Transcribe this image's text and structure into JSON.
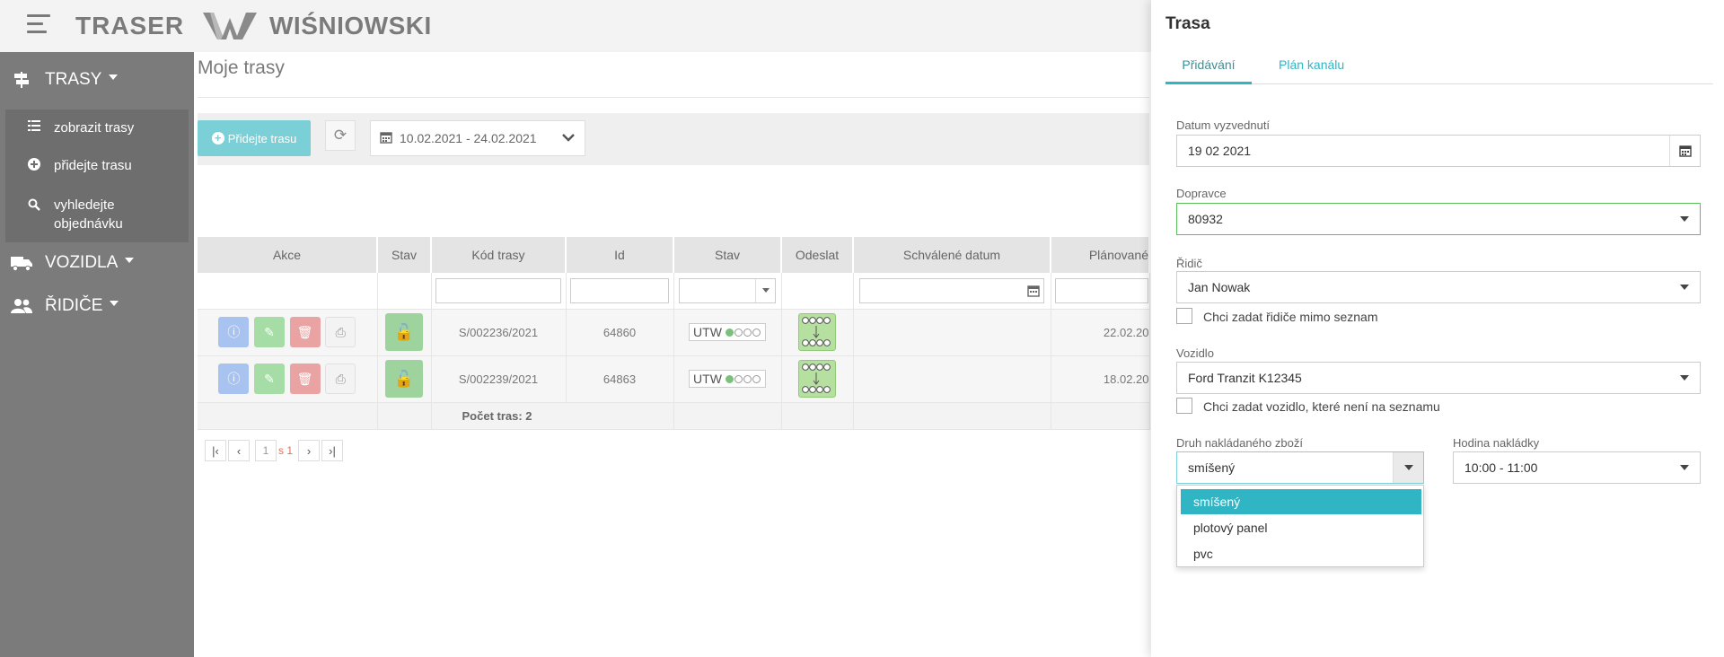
{
  "header": {
    "brand": "TRASER",
    "partner": "WIŚNIOWSKI"
  },
  "sidebar": {
    "groups": [
      {
        "label": "TRASY",
        "icon": "signpost-icon"
      },
      {
        "label": "VOZIDLA",
        "icon": "truck-icon"
      },
      {
        "label": "ŘIDIČE",
        "icon": "users-icon"
      }
    ],
    "subitems": [
      {
        "label": "zobrazit trasy",
        "icon": "list-icon"
      },
      {
        "label": "přidejte trasu",
        "icon": "plus-circle-icon"
      },
      {
        "label": "vyhledejte objednávku",
        "icon": "search-icon"
      }
    ]
  },
  "main": {
    "title": "Moje trasy",
    "add_button": "Přidejte trasu",
    "date_range": "10.02.2021 - 24.02.2021"
  },
  "table": {
    "columns": [
      "Akce",
      "Stav",
      "Kód trasy",
      "Id",
      "Stav",
      "Odeslat",
      "Schválené datum",
      "Plánované"
    ],
    "rows": [
      {
        "code": "S/002236/2021",
        "id": "64860",
        "status": "UTW",
        "planned": "22.02.20"
      },
      {
        "code": "S/002239/2021",
        "id": "64863",
        "status": "UTW",
        "planned": "18.02.20"
      }
    ],
    "summary": "Počet tras: 2"
  },
  "pager": {
    "current": "1",
    "of": "s 1"
  },
  "panel": {
    "title": "Trasa",
    "tabs": [
      "Přidávání",
      "Plán kanálu"
    ],
    "fields": {
      "pickup_date_label": "Datum vyzvednutí",
      "pickup_date": "19 02 2021",
      "carrier_label": "Dopravce",
      "carrier": "80932",
      "driver_label": "Řidič",
      "driver": "Jan Nowak",
      "driver_check": "Chci zadat řidiče mimo seznam",
      "vehicle_label": "Vozidlo",
      "vehicle": "Ford Tranzit K12345",
      "vehicle_check": "Chci zadat vozidlo, které není na seznamu",
      "goods_label": "Druh nakládaného zboží",
      "goods": "smíšený",
      "hour_label": "Hodina nakládky",
      "hour": "10:00 - 11:00"
    },
    "goods_options": [
      "smíšený",
      "plotový panel",
      "pvc"
    ]
  },
  "colors": {
    "accent": "#2fb5c3",
    "sidebar": "#7b7b7b",
    "success": "#5cc05c"
  }
}
